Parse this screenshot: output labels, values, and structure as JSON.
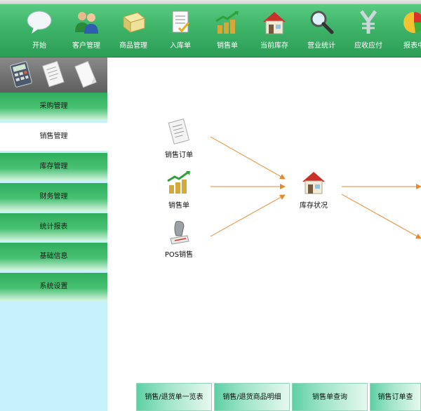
{
  "toolbar": {
    "items": [
      {
        "label": "开始",
        "icon": "chat-bubble-icon"
      },
      {
        "label": "客户管理",
        "icon": "users-icon"
      },
      {
        "label": "商品管理",
        "icon": "books-icon"
      },
      {
        "label": "入库单",
        "icon": "checklist-icon"
      },
      {
        "label": "销售单",
        "icon": "coins-chart-icon"
      },
      {
        "label": "当前库存",
        "icon": "house-icon"
      },
      {
        "label": "营业统计",
        "icon": "magnifier-icon"
      },
      {
        "label": "应收应付",
        "icon": "yen-icon"
      },
      {
        "label": "报表中",
        "icon": "pie-chart-icon"
      }
    ]
  },
  "sidebar": {
    "items": [
      {
        "label": "采购管理",
        "active": false
      },
      {
        "label": "销售管理",
        "active": true
      },
      {
        "label": "库存管理",
        "active": false
      },
      {
        "label": "财务管理",
        "active": false
      },
      {
        "label": "统计报表",
        "active": false
      },
      {
        "label": "基础信息",
        "active": false
      },
      {
        "label": "系统设置",
        "active": false
      }
    ]
  },
  "flow": {
    "sales_order": "销售订单",
    "sales_slip": "销售单",
    "pos_sales": "POS销售",
    "inventory_status": "库存状况"
  },
  "bottom_buttons": [
    {
      "label": "销售/退货单一览表"
    },
    {
      "label": "销售/退货商品明细"
    },
    {
      "label": "销售单查询"
    },
    {
      "label": "销售订单查"
    }
  ],
  "colors": {
    "toolbar_green": "#3fb66a",
    "sidebar_bg": "#c6f3fb",
    "arrow": "#e8892a",
    "bottom_button": "#9fe4c8"
  }
}
